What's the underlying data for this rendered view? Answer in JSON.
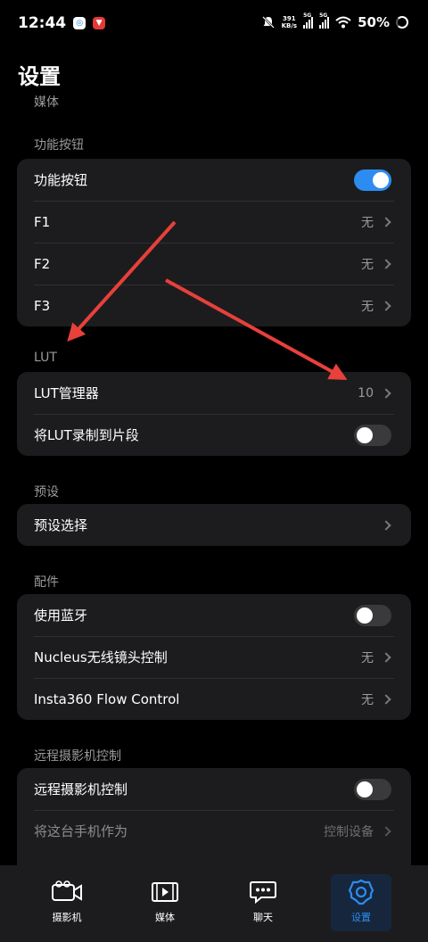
{
  "status_bar": {
    "time": "12:44",
    "speed_value": "391",
    "speed_unit": "KB/s",
    "sim1": "5G",
    "sim2": "5G",
    "battery": "50%",
    "icons": [
      "app-notification-icon",
      "app-notification-icon-2",
      "mute-icon",
      "signal-icon",
      "wifi-icon",
      "battery-icon"
    ]
  },
  "page": {
    "title": "设置",
    "scrolled_header": "媒体"
  },
  "sections": {
    "function_buttons": {
      "label": "功能按钮",
      "rows": [
        {
          "label": "功能按钮",
          "type": "toggle",
          "on": true
        },
        {
          "label": "F1",
          "value": "无"
        },
        {
          "label": "F2",
          "value": "无"
        },
        {
          "label": "F3",
          "value": "无"
        }
      ]
    },
    "lut": {
      "label": "LUT",
      "rows": [
        {
          "label": "LUT管理器",
          "value": "10"
        },
        {
          "label": "将LUT录制到片段",
          "type": "toggle",
          "on": false
        }
      ]
    },
    "preset": {
      "label": "预设",
      "rows": [
        {
          "label": "预设选择"
        }
      ]
    },
    "accessories": {
      "label": "配件",
      "rows": [
        {
          "label": "使用蓝牙",
          "type": "toggle",
          "on": false
        },
        {
          "label": "Nucleus无线镜头控制",
          "value": "无"
        },
        {
          "label": "Insta360 Flow Control",
          "value": "无"
        }
      ]
    },
    "remote": {
      "label": "远程摄影机控制",
      "rows": [
        {
          "label": "远程摄影机控制",
          "type": "toggle",
          "on": false
        },
        {
          "label": "将这台手机作为",
          "value": "控制设备"
        }
      ]
    }
  },
  "bottom_nav": [
    {
      "label": "摄影机",
      "icon": "camera-icon",
      "active": false
    },
    {
      "label": "媒体",
      "icon": "media-icon",
      "active": false
    },
    {
      "label": "聊天",
      "icon": "chat-icon",
      "active": false
    },
    {
      "label": "设置",
      "icon": "gear-icon",
      "active": true
    }
  ],
  "colors": {
    "accent": "#2d8cf0",
    "annotation_arrow": "#e8403a",
    "card": "#1c1c1e"
  }
}
